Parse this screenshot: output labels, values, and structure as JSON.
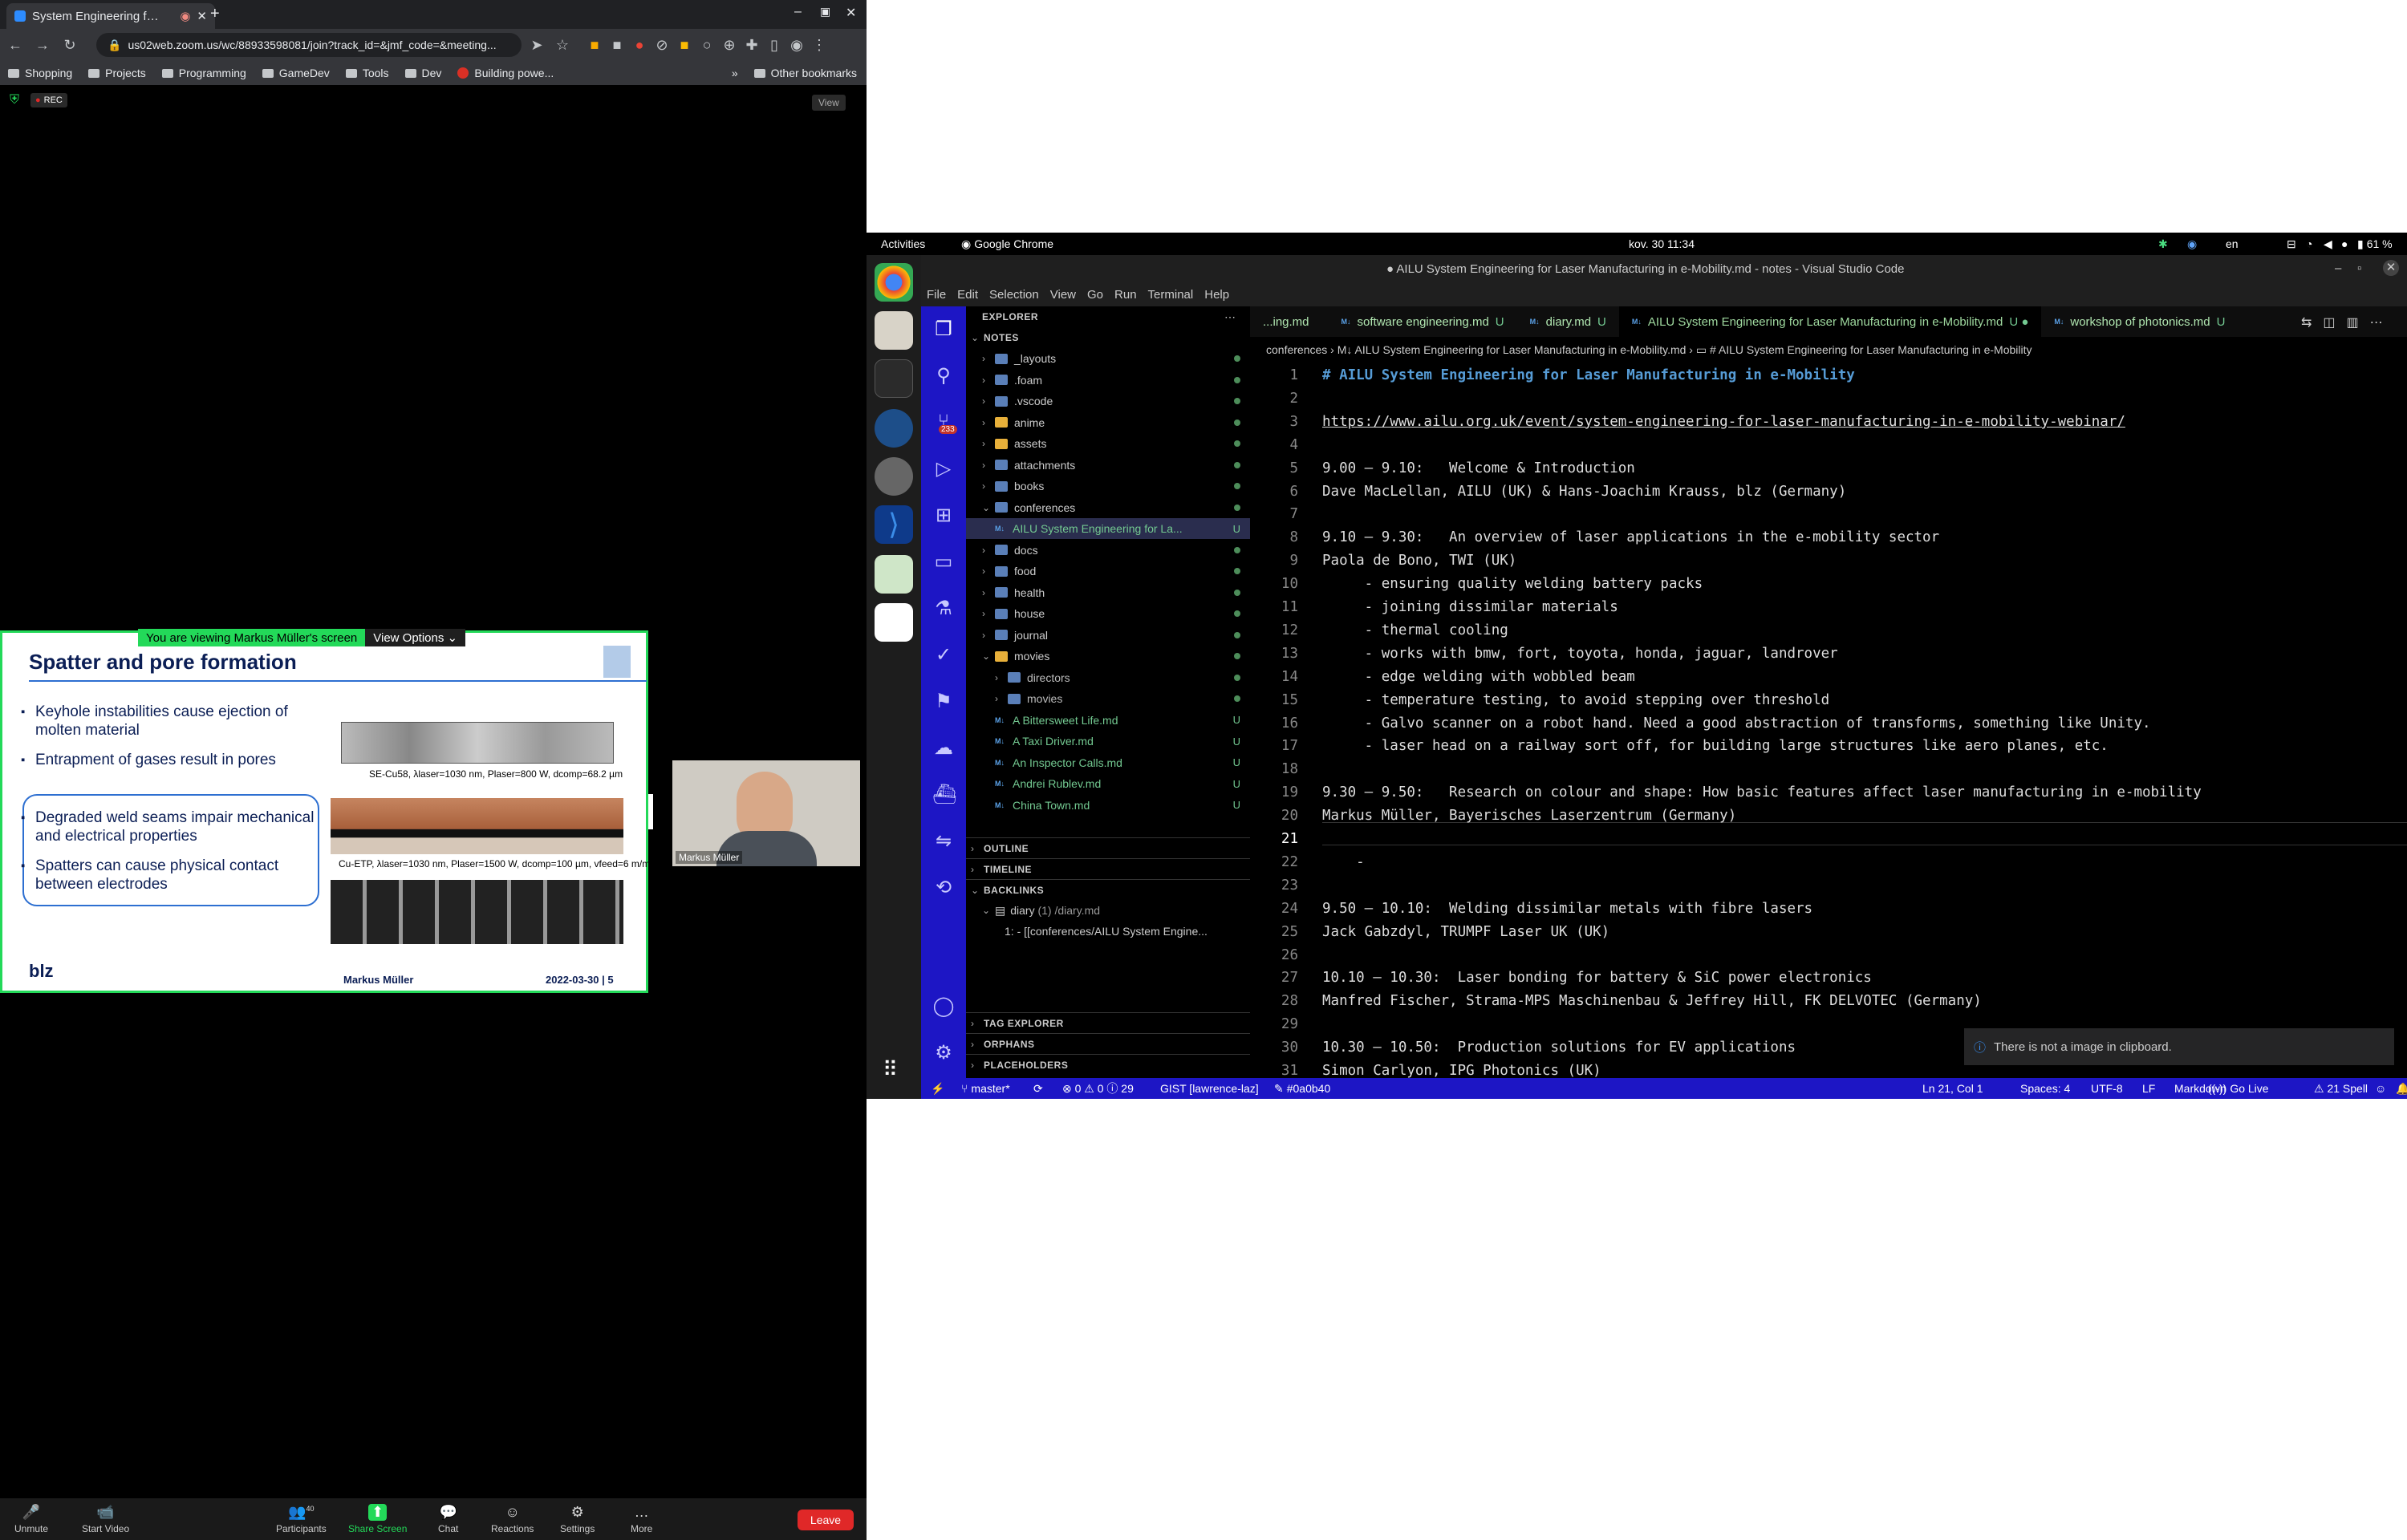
{
  "browser": {
    "tab_title": "System Engineering f…",
    "url": "us02web.zoom.us/wc/88933598081/join?track_id=&jmf_code=&meeting...",
    "bookmarks": [
      "Shopping",
      "Projects",
      "Programming",
      "GameDev",
      "Tools",
      "Dev",
      "Building powe..."
    ],
    "other_bookmarks": "Other bookmarks",
    "bm_more": "»"
  },
  "zoom": {
    "rec": "REC",
    "view": "View",
    "sharing_banner": "You are viewing Markus Müller's screen",
    "view_options": "View Options",
    "slide": {
      "title": "Spatter and pore formation",
      "b1": "Keyhole instabilities cause ejection of molten material",
      "b2": "Entrapment of gases result in pores",
      "b3": "Degraded weld seams impair mechanical and electrical properties",
      "b4": "Spatters can cause physical contact between electrodes",
      "cap1": "SE-Cu58, λlaser=1030 nm, Plaser=800 W, dcomp=68.2 µm",
      "cap2": "Cu-ETP, λlaser=1030 nm, Plaser=1500 W, dcomp=100 µm, vfeed=6 m/min",
      "presenter": "Markus Müller",
      "date_page": "2022-03-30 | 5",
      "logo": "blz"
    },
    "video_name": "Markus Müller",
    "controls": [
      {
        "label": "Unmute",
        "icon": "🎤"
      },
      {
        "label": "Start Video",
        "icon": "📹"
      },
      {
        "label": "Participants",
        "icon": "👥"
      },
      {
        "label": "Share Screen",
        "icon": "⬆"
      },
      {
        "label": "Chat",
        "icon": "💬"
      },
      {
        "label": "Reactions",
        "icon": "☺"
      },
      {
        "label": "Settings",
        "icon": "⚙"
      },
      {
        "label": "More",
        "icon": "…"
      }
    ],
    "participants_count": "40",
    "leave": "Leave"
  },
  "gnome": {
    "activities": "Activities",
    "app": "Google Chrome",
    "clock": "kov. 30  11:34",
    "lang": "en",
    "battery": "61 %"
  },
  "vscode": {
    "title": "● AILU System Engineering for Laser Manufacturing in e-Mobility.md - notes - Visual Studio Code",
    "menu": [
      "File",
      "Edit",
      "Selection",
      "View",
      "Go",
      "Run",
      "Terminal",
      "Help"
    ],
    "scm_badge": "233",
    "explorer": "EXPLORER",
    "notes": "NOTES",
    "tree": [
      {
        "name": "_layouts",
        "d": 1,
        "open": false
      },
      {
        "name": ".foam",
        "d": 1,
        "open": false
      },
      {
        "name": ".vscode",
        "d": 1,
        "open": false
      },
      {
        "name": "anime",
        "d": 1,
        "open": false
      },
      {
        "name": "assets",
        "d": 1,
        "open": false
      },
      {
        "name": "attachments",
        "d": 1,
        "open": false
      },
      {
        "name": "books",
        "d": 1,
        "open": false
      },
      {
        "name": "conferences",
        "d": 1,
        "open": true
      },
      {
        "name": "AILU System Engineering for La...",
        "d": 2,
        "file": true,
        "status": "U",
        "sel": true
      },
      {
        "name": "docs",
        "d": 1,
        "open": false
      },
      {
        "name": "food",
        "d": 1,
        "open": false
      },
      {
        "name": "health",
        "d": 1,
        "open": false
      },
      {
        "name": "house",
        "d": 1,
        "open": false
      },
      {
        "name": "journal",
        "d": 1,
        "open": false
      },
      {
        "name": "movies",
        "d": 1,
        "open": true
      },
      {
        "name": "directors",
        "d": 2,
        "open": false
      },
      {
        "name": "movies",
        "d": 2,
        "open": false
      },
      {
        "name": "A Bittersweet Life.md",
        "d": 2,
        "file": true,
        "status": "U"
      },
      {
        "name": "A Taxi Driver.md",
        "d": 2,
        "file": true,
        "status": "U"
      },
      {
        "name": "An Inspector Calls.md",
        "d": 2,
        "file": true,
        "status": "U"
      },
      {
        "name": "Andrei Rublev.md",
        "d": 2,
        "file": true,
        "status": "U"
      },
      {
        "name": "China Town.md",
        "d": 2,
        "file": true,
        "status": "U"
      }
    ],
    "outline": "OUTLINE",
    "timeline": "TIMELINE",
    "backlinks": "BACKLINKS",
    "bl_diary": "diary",
    "bl_count": "(1) /diary.md",
    "bl_line": "1: - [[conferences/AILU System Engine...",
    "tag_explorer": "TAG EXPLORER",
    "orphans": "ORPHANS",
    "placeholders": "PLACEHOLDERS",
    "tabs": [
      {
        "name": "...ing.md",
        "st": ""
      },
      {
        "name": "software engineering.md",
        "st": "U"
      },
      {
        "name": "diary.md",
        "st": "U"
      },
      {
        "name": "AILU System Engineering for Laser Manufacturing in e-Mobility.md",
        "st": "U ●",
        "active": true
      },
      {
        "name": "workshop of photonics.md",
        "st": "U"
      }
    ],
    "crumbs": "conferences  ›  M↓ AILU System Engineering for Laser Manufacturing in e-Mobility.md  ›  ▭ # AILU System Engineering for Laser Manufacturing in e-Mobility",
    "lines": [
      "# AILU System Engineering for Laser Manufacturing in e-Mobility",
      "",
      "https://www.ailu.org.uk/event/system-engineering-for-laser-manufacturing-in-e-mobility-webinar/",
      "",
      "9.00 – 9.10:   Welcome & Introduction",
      "Dave MacLellan, AILU (UK) & Hans-Joachim Krauss, blz (Germany)",
      "",
      "9.10 – 9.30:   An overview of laser applications in the e-mobility sector",
      "Paola de Bono, TWI (UK)",
      "     - ensuring quality welding battery packs",
      "     - joining dissimilar materials",
      "     - thermal cooling",
      "     - works with bmw, fort, toyota, honda, jaguar, landrover",
      "     - edge welding with wobbled beam",
      "     - temperature testing, to avoid stepping over threshold",
      "     - Galvo scanner on a robot hand. Need a good abstraction of transforms, something like Unity.",
      "     - laser head on a railway sort off, for building large structures like aero planes, etc.",
      "",
      "9.30 – 9.50:   Research on colour and shape: How basic features affect laser manufacturing in e-mobility",
      "Markus Müller, Bayerisches Laserzentrum (Germany)",
      "",
      "    -",
      "",
      "9.50 – 10.10:  Welding dissimilar metals with fibre lasers",
      "Jack Gabzdyl, TRUMPF Laser UK (UK)",
      "",
      "10.10 – 10.30:  Laser bonding for battery & SiC power electronics",
      "Manfred Fischer, Strama-MPS Maschinenbau & Jeffrey Hill, FK DELVOTEC (Germany)",
      "",
      "10.30 – 10.50:  Production solutions for EV applications",
      "Simon Carlyon, IPG Photonics (UK)"
    ],
    "notification": "There is not a image in clipboard.",
    "status": {
      "branch": "master*",
      "problems": "⊗ 0 ⚠ 0 ⓘ 29",
      "gist": "GIST [lawrence-laz]",
      "color": "#0a0b40",
      "pos": "Ln 21, Col 1",
      "spaces": "Spaces: 4",
      "enc": "UTF-8",
      "eol": "LF",
      "lang": "Markdown",
      "live": "Go Live",
      "spell": "⚠ 21 Spell"
    }
  }
}
